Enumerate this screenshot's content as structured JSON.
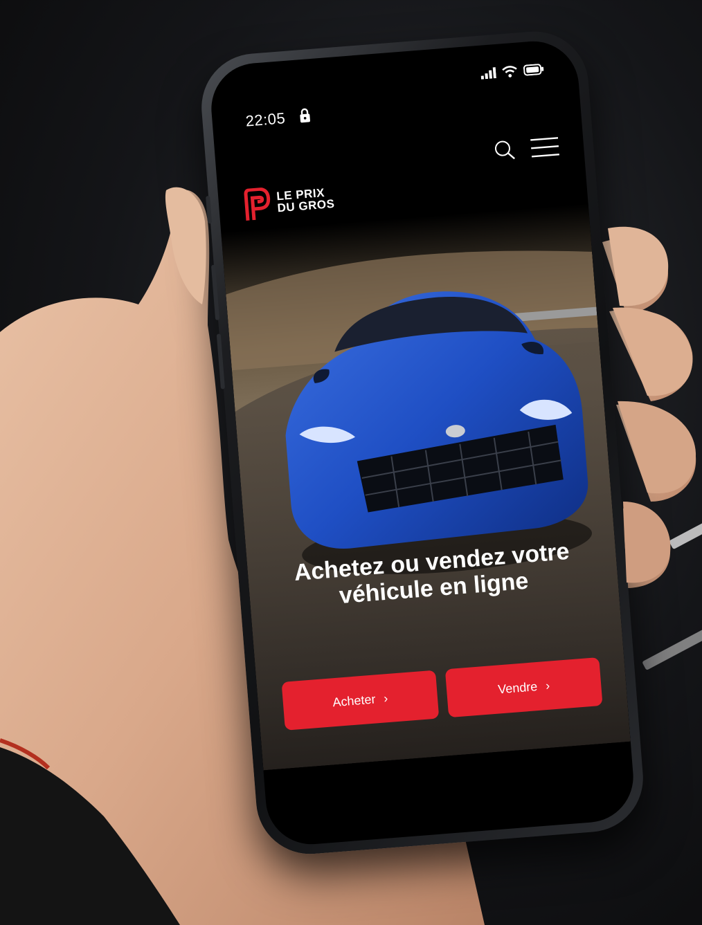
{
  "status_bar": {
    "time": "22:05"
  },
  "header": {
    "brand_line1": "LE PRIX",
    "brand_line2": "DU GROS"
  },
  "hero": {
    "title": "Achetez ou vendez votre véhicule en ligne"
  },
  "buttons": {
    "buy_label": "Acheter",
    "sell_label": "Vendre",
    "chevron": "›"
  },
  "colors": {
    "accent": "#e4212e",
    "screen_bg": "#000000",
    "text": "#ffffff"
  },
  "icons": {
    "search": "search-icon",
    "menu": "hamburger-menu-icon",
    "lock": "lock-icon",
    "signal": "signal-icon",
    "wifi": "wifi-icon",
    "battery": "battery-icon"
  }
}
